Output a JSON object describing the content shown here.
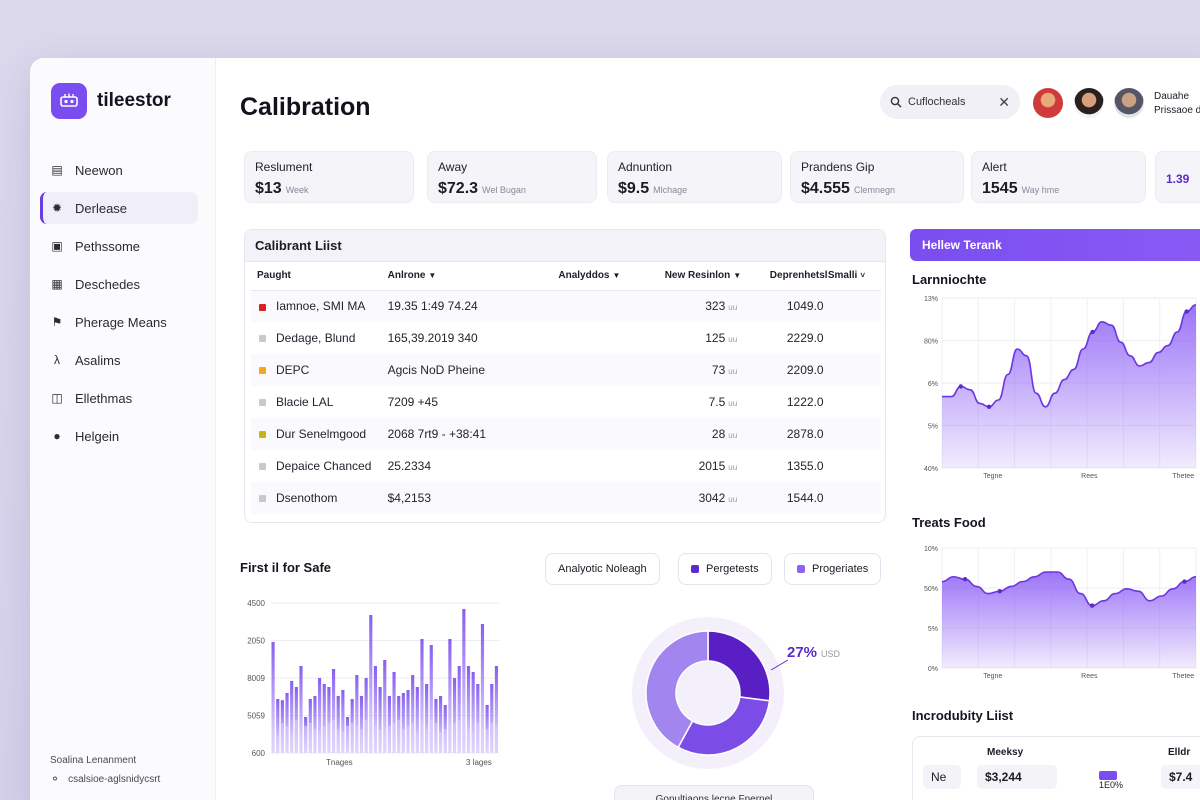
{
  "app": {
    "name": "tileestor"
  },
  "sidebar": {
    "items": [
      {
        "label": "Neewon",
        "icon": "document-icon",
        "active": false
      },
      {
        "label": "Derlease",
        "icon": "gear-icon",
        "active": true
      },
      {
        "label": "Pethssome",
        "icon": "camera-icon",
        "active": false
      },
      {
        "label": "Deschedes",
        "icon": "briefcase-icon",
        "active": false
      },
      {
        "label": "Pherage Means",
        "icon": "tag-icon",
        "active": false
      },
      {
        "label": "Asalims",
        "icon": "lambda-icon",
        "active": false
      },
      {
        "label": "Ellethmas",
        "icon": "folder-icon",
        "active": false
      },
      {
        "label": "Helgein",
        "icon": "person-icon",
        "active": false
      }
    ],
    "footer": {
      "title": "Soalina Lenanment",
      "subtitle": "csalsioe-aglsnidycsrt"
    }
  },
  "header": {
    "title": "Calibration",
    "search": {
      "value": "Cuflocheals"
    },
    "user": {
      "name": "Dauahe",
      "role": "Prissaoe d"
    }
  },
  "stats": [
    {
      "label": "Reslument",
      "value": "$13",
      "sub": "Week"
    },
    {
      "label": "Away",
      "value": "$72.3",
      "sub": "Wel Bugan"
    },
    {
      "label": "Adnuntion",
      "value": "$9.5",
      "sub": "Mlchage"
    },
    {
      "label": "Prandens Gip",
      "value": "$4.555",
      "sub": "Clemnegn"
    },
    {
      "label": "Alert",
      "value": "1545",
      "sub": "Way hme"
    },
    {
      "label": "",
      "value": "1.39",
      "sub": ""
    }
  ],
  "calibrant_list": {
    "title": "Calibrant Liist",
    "columns": [
      "Paught",
      "Anlrone",
      "Analyddos",
      "New Resinlon",
      "Deprenhetsl",
      "Smalli"
    ],
    "rows": [
      {
        "color": "#d8202a",
        "name": "Iamnoe, SMI MA",
        "code": "19.35 1:49 74.24",
        "value": "323",
        "dep": "1049.0"
      },
      {
        "color": "#c9c8d2",
        "name": "Dedage, Blund",
        "code": "165,39.2019 340",
        "value": "125",
        "dep": "2229.0"
      },
      {
        "color": "#f5a623",
        "name": "DEPC",
        "code": "Agcis NoD Pheine",
        "value": "73",
        "dep": "2209.0"
      },
      {
        "color": "#c9c8d2",
        "name": "Blacie LAL",
        "code": "7209 +45",
        "value": "7.5",
        "dep": "1222.0"
      },
      {
        "color": "#c8b41c",
        "name": "Dur Senelmgood",
        "code": "2068 7rt9 - +38:41",
        "value": "28",
        "dep": "2878.0"
      },
      {
        "color": "#c9c8d2",
        "name": "Depaice Chanced",
        "code": "25.2334",
        "value": "2015",
        "dep": "1355.0"
      },
      {
        "color": "#c9c8d2",
        "name": "Dsenothom",
        "code": "$4,2153",
        "value": "3042",
        "dep": "1544.0"
      }
    ]
  },
  "bar_section": {
    "title": "First il for Safe",
    "xlabels": [
      "Tnages",
      "3 lages"
    ]
  },
  "donut_section": {
    "pills": [
      {
        "label": "Analyotic Noleagh",
        "swatch": ""
      },
      {
        "label": "Pergetests",
        "swatch": "#5a2cc9"
      },
      {
        "label": "Progeriates",
        "swatch": "#8d63f0"
      }
    ],
    "percent_label": "27%",
    "percent_sub": "USD",
    "caption": "Gonultiaons lecne Fnernel"
  },
  "right": {
    "banner": "Hellew Terank",
    "chart1_title": "Larnniochte",
    "chart2_title": "Treats Food",
    "list_title": "Incrodubity Liist",
    "mini_table": {
      "headers": [
        "Meeksy",
        "Elldr"
      ],
      "cells": [
        "Ne",
        "$3,244",
        "1E0%",
        "$7.4"
      ]
    }
  },
  "chart_data": [
    {
      "type": "bar",
      "title": "First il for Safe",
      "ylim": [
        0,
        4000
      ],
      "yticks": [
        "4500",
        "2050",
        "8009",
        "5059",
        "600"
      ],
      "series": [
        {
          "values": [
            1850,
            900,
            880,
            1000,
            1200,
            1100,
            1450,
            600,
            900,
            950,
            1250,
            1150,
            1100,
            1400,
            950,
            1050,
            600,
            900,
            1300,
            950,
            1250,
            2300,
            1450,
            1100,
            1550,
            950,
            1350,
            950,
            1000,
            1050,
            1300,
            1100,
            1900,
            1150,
            1800,
            900,
            950,
            800,
            1900,
            1250,
            1450,
            2400,
            1450,
            1350,
            1150,
            2150,
            800,
            1150,
            1450
          ]
        },
        {
          "values": [
            400,
            300,
            500,
            450,
            300,
            550,
            350,
            450,
            500,
            400,
            350,
            450,
            500,
            550,
            400,
            350,
            450,
            500,
            450,
            400,
            550,
            500,
            450,
            400,
            350,
            450,
            500,
            550,
            400,
            450,
            500,
            350,
            450,
            400,
            550,
            500,
            350,
            400,
            450,
            500,
            550,
            450,
            400,
            350,
            500,
            450,
            400,
            500,
            450
          ]
        }
      ]
    },
    {
      "type": "pie",
      "values": [
        27,
        31,
        42
      ],
      "labels": [
        "",
        "",
        ""
      ]
    },
    {
      "type": "area",
      "title": "Larnniochte",
      "yticks": [
        "13%",
        "80%",
        "6%",
        "5%",
        "40%"
      ],
      "xticks": [
        "Tegne",
        "Rees",
        "Thetee"
      ],
      "y": [
        42,
        42,
        48,
        46,
        38,
        36,
        40,
        55,
        70,
        66,
        44,
        36,
        44,
        52,
        58,
        70,
        80,
        86,
        84,
        74,
        66,
        60,
        62,
        68,
        72,
        80,
        92,
        96
      ]
    },
    {
      "type": "area",
      "title": "Treats Food",
      "yticks": [
        "10%",
        "50%",
        "5%",
        "0%"
      ],
      "xticks": [
        "Tegne",
        "Rees",
        "Thetee"
      ],
      "y": [
        72,
        76,
        74,
        68,
        62,
        64,
        68,
        72,
        76,
        80,
        80,
        74,
        62,
        52,
        56,
        62,
        66,
        64,
        56,
        60,
        66,
        72,
        76
      ]
    }
  ]
}
